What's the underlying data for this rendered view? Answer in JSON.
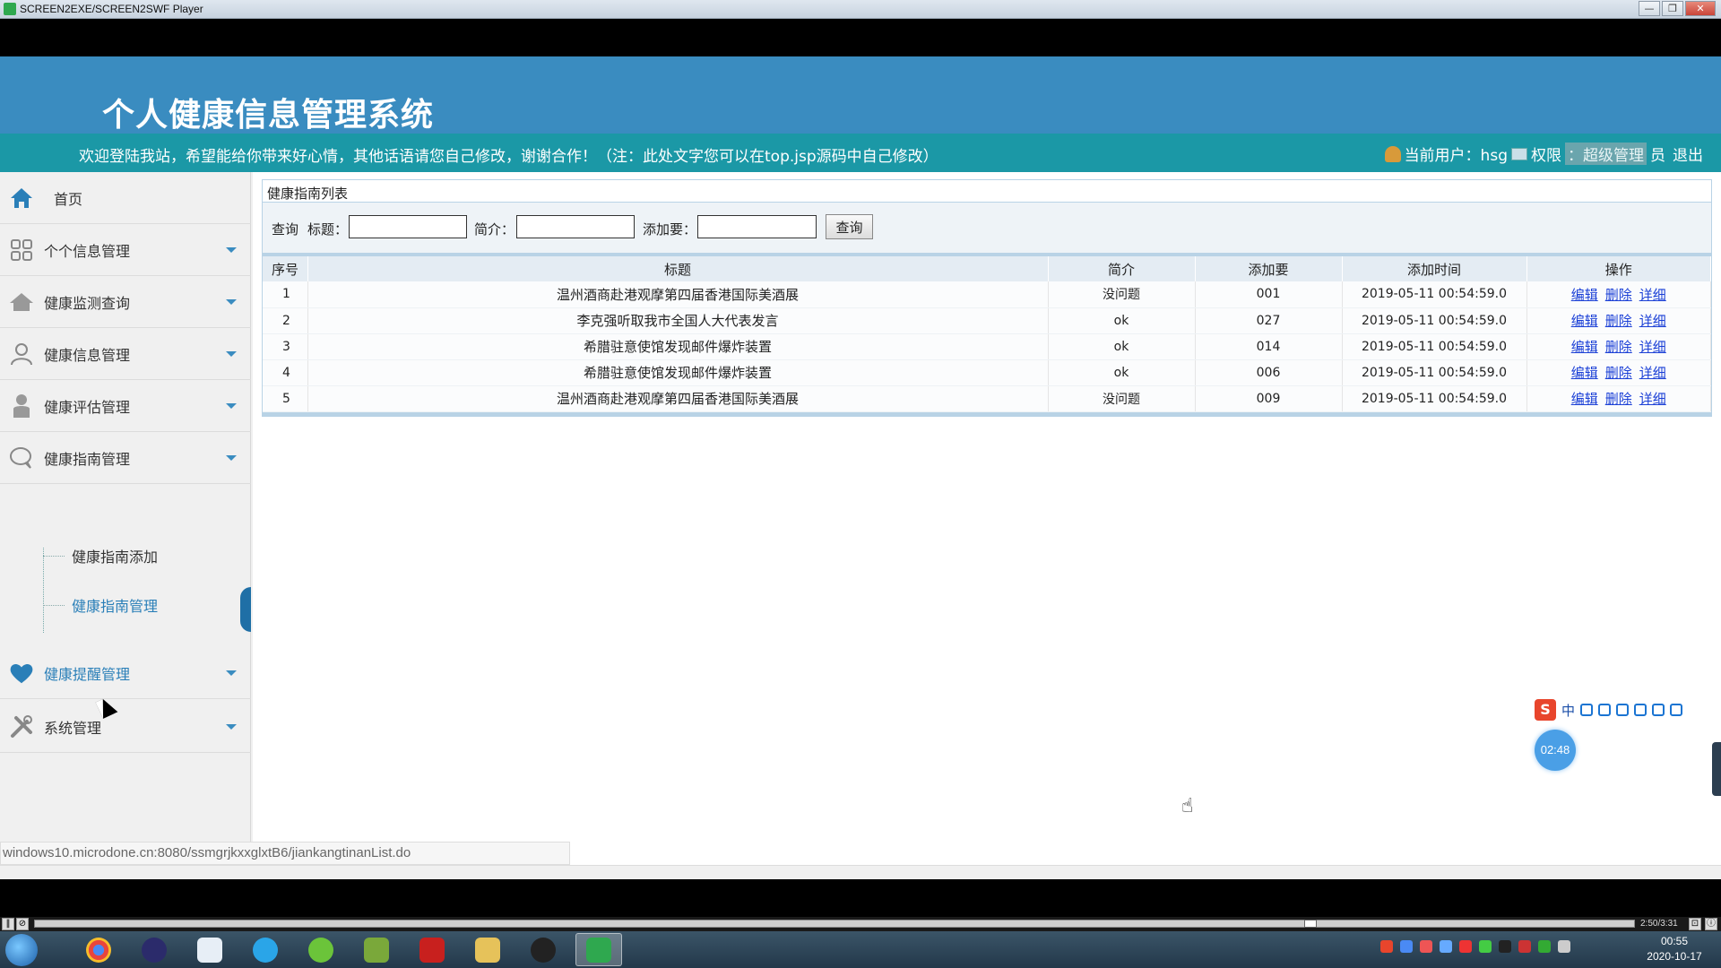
{
  "player": {
    "title": "SCREEN2EXE/SCREEN2SWF Player",
    "window_buttons": [
      "—",
      "❐",
      "✕"
    ],
    "time": "2:50/3:31",
    "progress": 0.8
  },
  "header": {
    "system_title": "个人健康信息管理系统",
    "welcome_text": "欢迎登陆我站，希望能给你带来好心情，其他话语请您自己修改，谢谢合作！（注：此处文字您可以在top.jsp源码中自己修改）",
    "current_user_label": "当前用户：hsg",
    "permission_label": "权限",
    "role_text": "：超级管理",
    "role_suffix": "员",
    "logout_label": "退出"
  },
  "sidebar": {
    "home": "首页",
    "items": [
      {
        "label": "个个信息管理",
        "icon": "grid-icon"
      },
      {
        "label": "健康监测查询",
        "icon": "house-icon"
      },
      {
        "label": "健康信息管理",
        "icon": "people-icon"
      },
      {
        "label": "健康评估管理",
        "icon": "person-icon"
      },
      {
        "label": "健康指南管理",
        "icon": "chat-icon"
      },
      {
        "label": "健康提醒管理",
        "icon": "heart-icon"
      },
      {
        "label": "系统管理",
        "icon": "tools-icon"
      }
    ],
    "submenu": [
      "健康指南添加",
      "健康指南管理"
    ]
  },
  "panel": {
    "title": "健康指南列表",
    "search": {
      "prefix": "查询",
      "title_label": "标题：",
      "intro_label": "简介：",
      "adder_label": "添加要：",
      "title_value": "",
      "intro_value": "",
      "adder_value": "",
      "button": "查询"
    },
    "columns": [
      "序号",
      "标题",
      "简介",
      "添加要",
      "添加时间",
      "操作"
    ],
    "rows": [
      {
        "no": "1",
        "title": "温州酒商赴港观摩第四届香港国际美酒展",
        "intro": "没问题",
        "adder": "001",
        "time": "2019-05-11 00:54:59.0"
      },
      {
        "no": "2",
        "title": "李克强听取我市全国人大代表发言",
        "intro": "ok",
        "adder": "027",
        "time": "2019-05-11 00:54:59.0"
      },
      {
        "no": "3",
        "title": "希腊驻意使馆发现邮件爆炸装置",
        "intro": "ok",
        "adder": "014",
        "time": "2019-05-11 00:54:59.0"
      },
      {
        "no": "4",
        "title": "希腊驻意使馆发现邮件爆炸装置",
        "intro": "ok",
        "adder": "006",
        "time": "2019-05-11 00:54:59.0"
      },
      {
        "no": "5",
        "title": "温州酒商赴港观摩第四届香港国际美酒展",
        "intro": "没问题",
        "adder": "009",
        "time": "2019-05-11 00:54:59.0"
      }
    ],
    "ops": {
      "edit": "编辑",
      "delete": "删除",
      "detail": "详细"
    }
  },
  "status_url": "windows10.microdone.cn:8080/ssmgrjkxxglxtB6/jiankangtinanList.do",
  "ime": {
    "logo": "S",
    "mode": "中"
  },
  "timer": "02:48",
  "taskbar": {
    "clock_time": "00:55",
    "clock_date": "2020-10-17"
  }
}
